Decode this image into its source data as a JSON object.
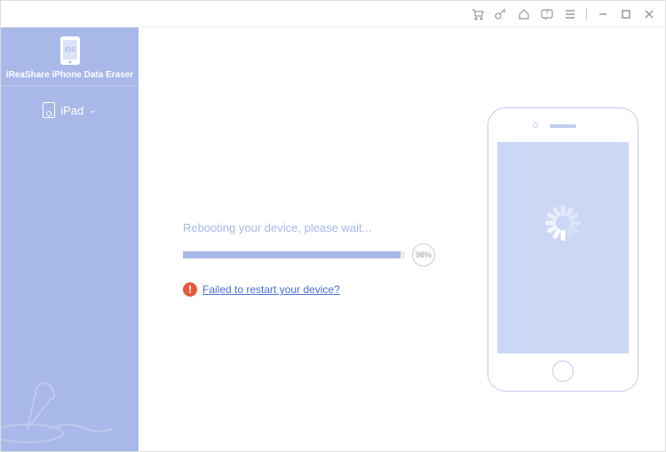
{
  "brand": "iReaShare iPhone Data Eraser",
  "device": {
    "name": "iPad"
  },
  "status": {
    "message": "Rebooting your device, please wait...",
    "percent": "98%",
    "percent_value": 98
  },
  "error": {
    "link_text": "Failed to restart your device?"
  }
}
